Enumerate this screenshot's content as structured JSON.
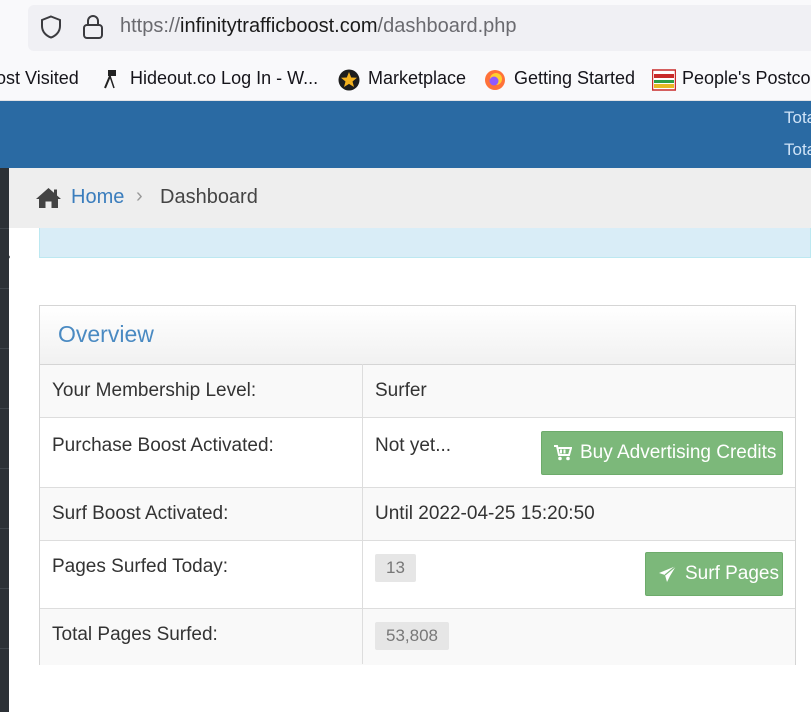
{
  "browser": {
    "url_prefix": "https://",
    "url_domain": "infinitytrafficboost.com",
    "url_path": "/dashboard.php",
    "bookmarks": [
      {
        "label": "ost Visited",
        "icon": "none"
      },
      {
        "label": "Hideout.co Log In - W...",
        "icon": "lamp-icon"
      },
      {
        "label": "Marketplace",
        "icon": "star-badge-icon"
      },
      {
        "label": "Getting Started",
        "icon": "firefox-icon"
      },
      {
        "label": "People's Postcod",
        "icon": "postcode-icon"
      }
    ]
  },
  "header": {
    "stat_1": "Tota",
    "stat_2": "Tota"
  },
  "breadcrumb": {
    "home": "Home",
    "separator": "›",
    "current": "Dashboard"
  },
  "overview": {
    "title": "Overview",
    "rows": [
      {
        "label": "Your Membership Level:",
        "value": "Surfer"
      },
      {
        "label": "Purchase Boost Activated:",
        "value": "Not yet..."
      },
      {
        "label": "Surf Boost Activated:",
        "value": "Until 2022-04-25 15:20:50"
      },
      {
        "label": "Pages Surfed Today:",
        "value": "13"
      },
      {
        "label": "Total Pages Surfed:",
        "value": "53,808"
      }
    ],
    "buy_button": "Buy Advertising Credits",
    "surf_button": "Surf Pages"
  },
  "colors": {
    "header_blue": "#2a6aa3",
    "link_blue": "#3a7dbd",
    "button_green": "#7cb87a",
    "panel_title": "#4a8ac2"
  }
}
